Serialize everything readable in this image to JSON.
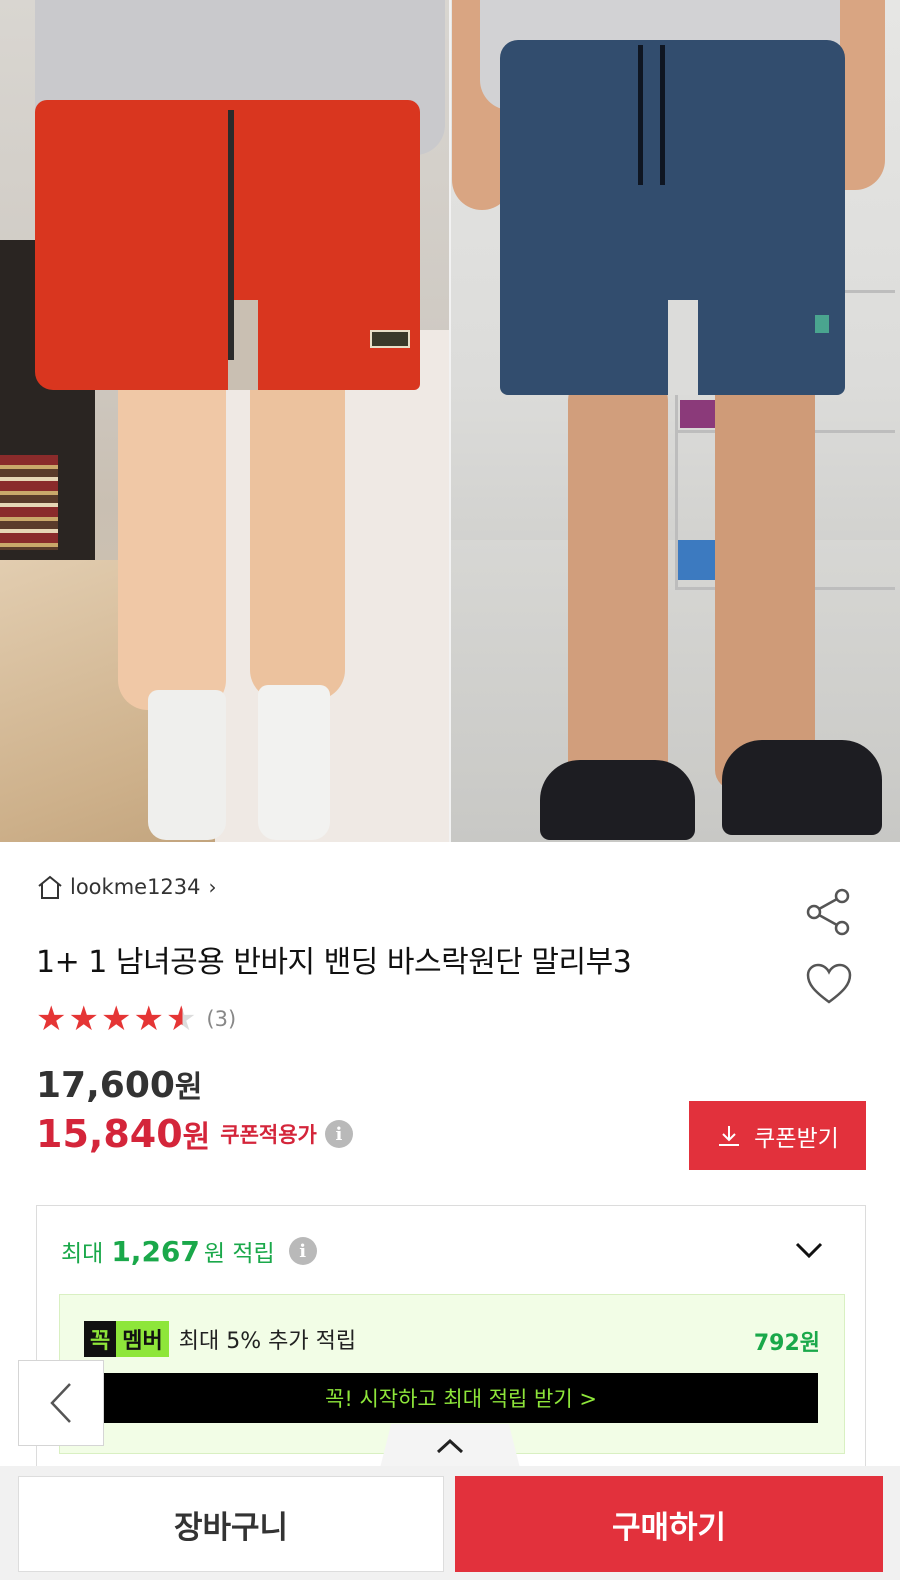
{
  "store": {
    "name": "lookme1234",
    "chevron": "›"
  },
  "product": {
    "title": "1+ 1 남녀공용 반바지 밴딩 바스락원단 말리부3",
    "rating": 4.5,
    "rating_count": "(3)"
  },
  "price": {
    "original_num": "17,600",
    "original_unit": "원",
    "sale_num": "15,840",
    "sale_unit": "원",
    "sale_label": "쿠폰적용가",
    "coupon_button": "쿠폰받기"
  },
  "points": {
    "prefix": "최대",
    "amount": "1,267",
    "suffix": "원 적립",
    "member": {
      "badge_1": "꼭",
      "badge_2": "멤버",
      "text": "최대 5% 추가 적립",
      "amount": "792원",
      "cta": "꼭! 시작하고 최대 적립 받기  >"
    }
  },
  "bottom": {
    "cart_label": "장바구니",
    "buy_label": "구매하기"
  },
  "colors": {
    "accent_red": "#e2313c",
    "price_red": "#d4253a",
    "points_green": "#1aa84a",
    "member_lime": "#8ee63a"
  },
  "icons": [
    "home-icon",
    "share-icon",
    "heart-icon",
    "info-icon",
    "download-icon",
    "chevron-down-icon",
    "chevron-left-icon",
    "chevron-up-icon"
  ]
}
